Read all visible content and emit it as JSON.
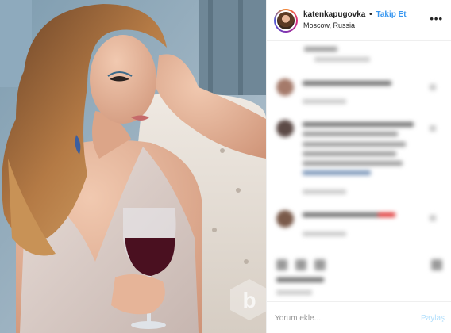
{
  "post": {
    "username": "katenkapugovka",
    "separator": "•",
    "follow_label": "Takip Et",
    "location": "Moscow, Russia",
    "more_icon": "more-dots-icon"
  },
  "add_comment": {
    "placeholder": "Yorum ekle...",
    "share_label": "Paylaş"
  },
  "colors": {
    "follow_blue": "#3897f0",
    "share_disabled": "#b2dffc",
    "border": "#efefef"
  }
}
